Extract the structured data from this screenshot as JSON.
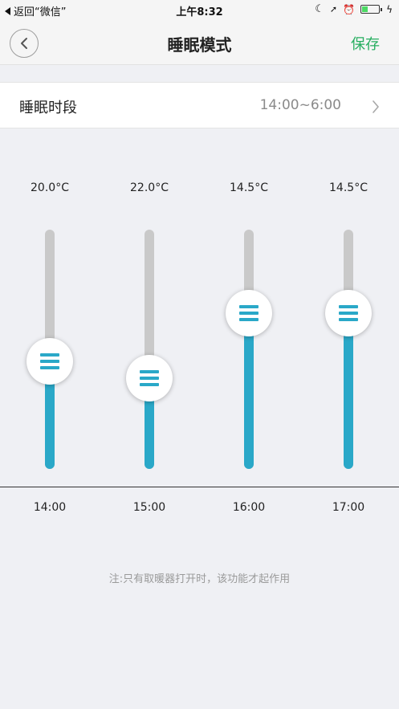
{
  "status_bar": {
    "back_app": "返回“微信”",
    "time": "上午8:32",
    "icons": [
      "moon-icon",
      "location-icon",
      "alarm-icon",
      "battery-icon",
      "charging-icon"
    ]
  },
  "nav": {
    "title": "睡眠模式",
    "save_label": "保存",
    "back_icon": "chevron-left-icon"
  },
  "sleep_period": {
    "label": "睡眠时段",
    "value": "14:00~6:00"
  },
  "sliders": [
    {
      "temp": "20.0°C",
      "time": "14:00",
      "level": 0.45
    },
    {
      "temp": "22.0°C",
      "time": "15:00",
      "level": 0.38
    },
    {
      "temp": "14.5°C",
      "time": "16:00",
      "level": 0.65
    },
    {
      "temp": "14.5°C",
      "time": "17:00",
      "level": 0.65
    }
  ],
  "note": "注:只有取暖器打开时，该功能才起作用",
  "colors": {
    "accent": "#2aa8c8",
    "save_green": "#27ae60",
    "track_gray": "#c9c9c9",
    "background": "#eff0f4"
  }
}
